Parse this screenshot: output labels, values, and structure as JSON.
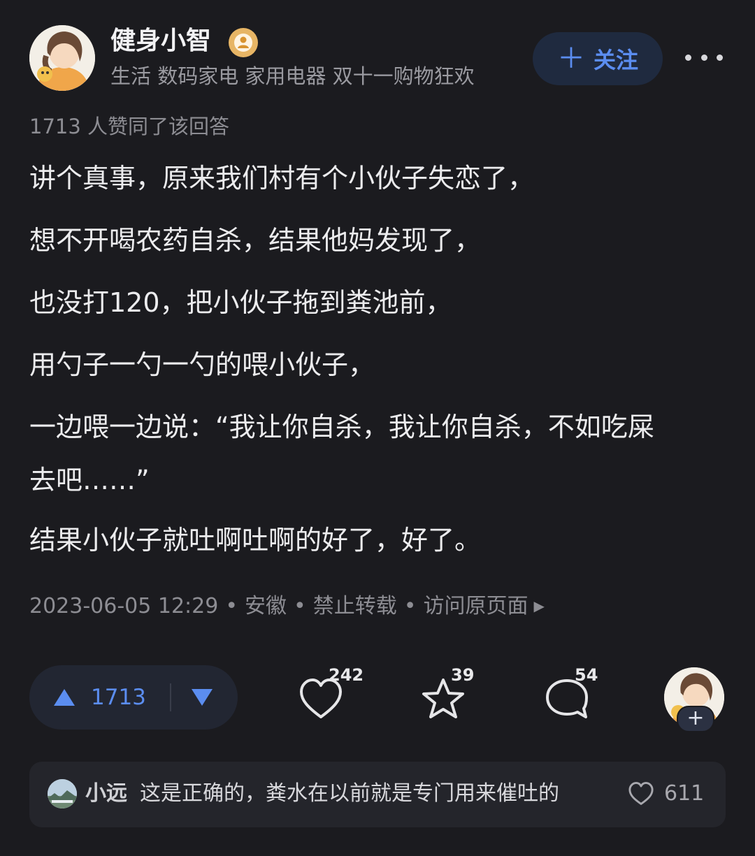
{
  "author": {
    "name": "健身小智",
    "tags": "生活 数码家电 家用电器 双十一购物狂欢",
    "avatar_icon": "cartoon-girl-avatar",
    "badge_icon": "person-badge-icon"
  },
  "follow": {
    "label": "关注",
    "icon": "plus-icon"
  },
  "agree_text": "1713 人赞同了该回答",
  "answer": {
    "paragraphs": [
      "讲个真事，原来我们村有个小伙子失恋了，",
      "想不开喝农药自杀，结果他妈发现了，",
      "也没打120，把小伙子拖到粪池前，",
      "用勺子一勺一勺的喂小伙子，"
    ],
    "para5_line1": "一边喂一边说：“我让你自杀，我让你自杀，不如吃屎",
    "para5_line2": "去吧……”",
    "para6": "结果小伙子就吐啊吐啊的好了，好了。"
  },
  "meta": {
    "date": "2023-06-05 12:29",
    "location": "安徽",
    "copyright": "禁止转载",
    "visit_label": "访问原页面",
    "separator": "•"
  },
  "actions": {
    "upvote_count": "1713",
    "like_count": "242",
    "favorite_count": "39",
    "comment_count": "54"
  },
  "top_comment": {
    "user": "小远",
    "text": "这是正确的，粪水在以前就是专门用来催吐的",
    "likes": "611"
  },
  "colors": {
    "background": "#1b1b1f",
    "accent_blue": "#5b8df0",
    "badge_gold": "#e7b565"
  }
}
